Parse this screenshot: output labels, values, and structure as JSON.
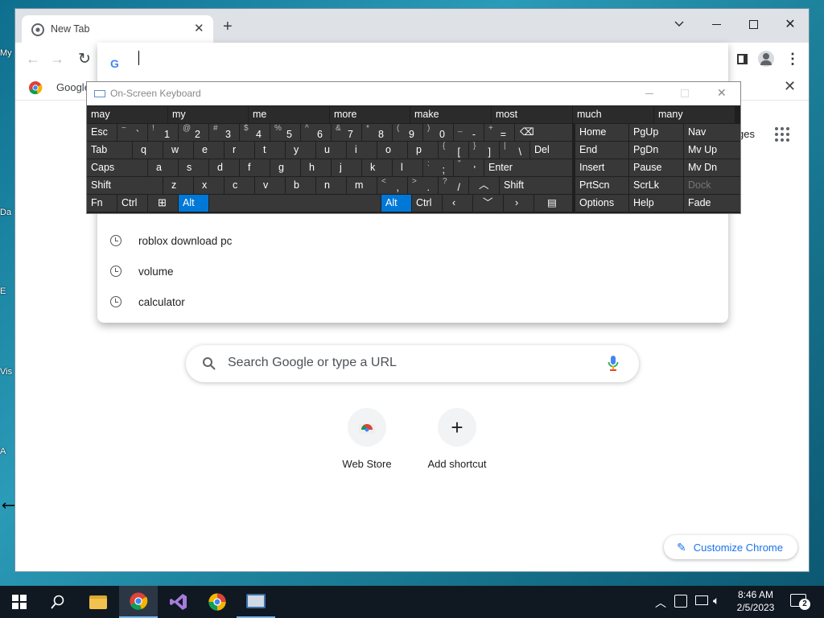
{
  "browser": {
    "tab_title": "New Tab",
    "bookmark_label": "Google",
    "omnibox_value": "",
    "suggestions": [
      "roblox download pc",
      "volume",
      "calculator"
    ],
    "search_placeholder": "Search Google or type a URL",
    "shortcuts": [
      {
        "label": "Web Store",
        "icon": "web-store-icon"
      },
      {
        "label": "Add shortcut",
        "icon": "plus-icon"
      }
    ],
    "customize_label": "Customize Chrome",
    "partial_text_right": "ges"
  },
  "desktop": {
    "icon_labels": [
      "My",
      "Da",
      "E",
      "Vis",
      "A"
    ]
  },
  "osk": {
    "title": "On-Screen Keyboard",
    "predictions": [
      "may",
      "my",
      "me",
      "more",
      "make",
      "most",
      "much",
      "many"
    ],
    "row1": [
      {
        "s": "~",
        "m": "`"
      },
      {
        "s": "!",
        "m": "1"
      },
      {
        "s": "@",
        "m": "2"
      },
      {
        "s": "#",
        "m": "3"
      },
      {
        "s": "$",
        "m": "4"
      },
      {
        "s": "%",
        "m": "5"
      },
      {
        "s": "^",
        "m": "6"
      },
      {
        "s": "&",
        "m": "7"
      },
      {
        "s": "*",
        "m": "8"
      },
      {
        "s": "(",
        "m": "9"
      },
      {
        "s": ")",
        "m": "0"
      },
      {
        "s": "_",
        "m": "-"
      },
      {
        "s": "+",
        "m": "="
      }
    ],
    "esc": "Esc",
    "row2": [
      "q",
      "w",
      "e",
      "r",
      "t",
      "y",
      "u",
      "i",
      "o",
      "p"
    ],
    "tab": "Tab",
    "bracket_keys": [
      {
        "s": "{",
        "m": "["
      },
      {
        "s": "}",
        "m": "]"
      },
      {
        "s": "|",
        "m": "\\"
      }
    ],
    "del": "Del",
    "caps": "Caps",
    "row3": [
      "a",
      "s",
      "d",
      "f",
      "g",
      "h",
      "j",
      "k",
      "l"
    ],
    "semi_keys": [
      {
        "s": ":",
        "m": ";"
      },
      {
        "s": "\"",
        "m": "'"
      }
    ],
    "enter": "Enter",
    "shift": "Shift",
    "row4": [
      "z",
      "x",
      "c",
      "v",
      "b",
      "n",
      "m"
    ],
    "punct_keys": [
      {
        "s": "<",
        "m": ","
      },
      {
        "s": ">",
        "m": "."
      },
      {
        "s": "?",
        "m": "/"
      }
    ],
    "fn": "Fn",
    "ctrl": "Ctrl",
    "alt": "Alt",
    "nav_keys": [
      [
        "Home",
        "PgUp",
        "Nav"
      ],
      [
        "End",
        "PgDn",
        "Mv Up"
      ],
      [
        "Insert",
        "Pause",
        "Mv Dn"
      ],
      [
        "PrtScn",
        "ScrLk",
        "Dock"
      ],
      [
        "Options",
        "Help",
        "Fade"
      ]
    ]
  },
  "taskbar": {
    "time": "8:46 AM",
    "date": "2/5/2023",
    "notification_count": "2"
  },
  "colors": {
    "accent_blue": "#0078d7",
    "chrome_link": "#1a73e8",
    "taskbar": "#101822"
  }
}
